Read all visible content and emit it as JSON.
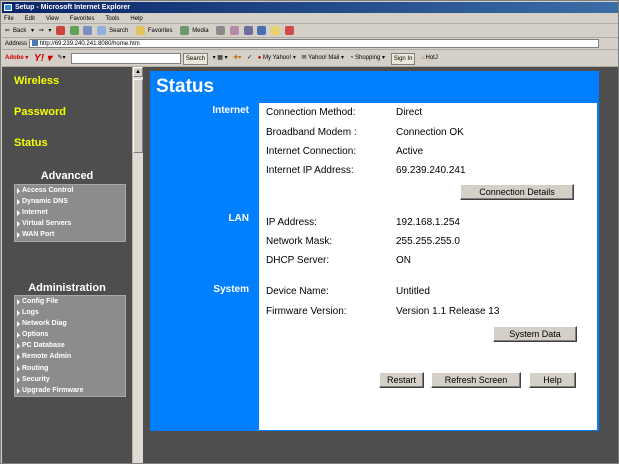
{
  "window": {
    "title": "Setup - Microsoft Internet Explorer"
  },
  "menubar": {
    "items": [
      "File",
      "Edit",
      "View",
      "Favorites",
      "Tools",
      "Help"
    ]
  },
  "toolbar": {
    "back": "Back",
    "search": "Search",
    "favorites": "Favorites",
    "media": "Media"
  },
  "address": {
    "label": "Address",
    "url": "http://69.239.240.241:8080/home.htm"
  },
  "yahoo": {
    "adobe": "Adobe",
    "search_btn": "Search",
    "my_yahoo": "My Yahoo!",
    "mail": "Yahoo! Mail",
    "shopping": "Shopping",
    "signin": "Sign In",
    "hotjobs": "HotJ"
  },
  "sidebar": {
    "main": [
      "Wireless",
      "Password",
      "Status"
    ],
    "advanced": {
      "heading": "Advanced",
      "items": [
        "Access Control",
        "Dynamic DNS",
        "Internet",
        "Virtual Servers",
        "WAN Port"
      ]
    },
    "administration": {
      "heading": "Administration",
      "items": [
        "Config File",
        "Logs",
        "Network Diag",
        "Options",
        "PC Database",
        "Remote Admin",
        "Routing",
        "Security",
        "Upgrade Firmware"
      ]
    }
  },
  "page": {
    "title": "Status",
    "internet": {
      "section": "Internet",
      "rows": [
        {
          "label": "Connection Method:",
          "value": "Direct"
        },
        {
          "label": "Broadband Modem :",
          "value": "Connection OK"
        },
        {
          "label": "Internet Connection:",
          "value": "Active"
        },
        {
          "label": "Internet IP Address:",
          "value": "69.239.240.241"
        }
      ],
      "details_btn": "Connection Details"
    },
    "lan": {
      "section": "LAN",
      "rows": [
        {
          "label": "IP Address:",
          "value": "192.168.1.254"
        },
        {
          "label": "Network Mask:",
          "value": "255.255.255.0"
        },
        {
          "label": "DHCP Server:",
          "value": "ON"
        }
      ]
    },
    "system": {
      "section": "System",
      "rows": [
        {
          "label": "Device Name:",
          "value": "Untitled"
        },
        {
          "label": "Firmware Version:",
          "value": "Version 1.1 Release 13"
        }
      ],
      "data_btn": "System Data"
    },
    "buttons": {
      "restart": "Restart",
      "refresh": "Refresh Screen",
      "help": "Help"
    }
  }
}
